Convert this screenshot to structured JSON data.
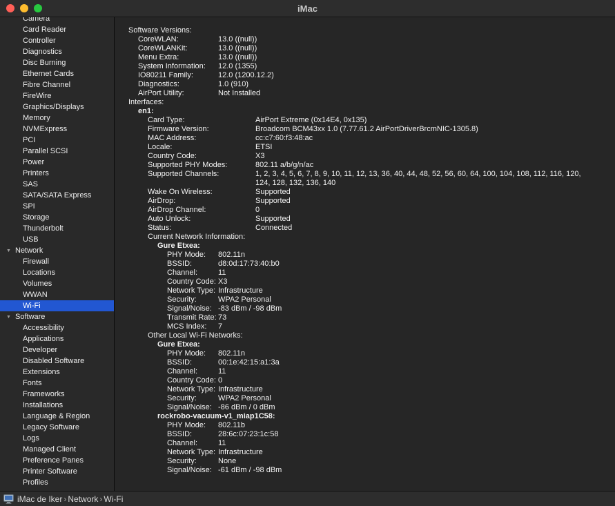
{
  "window": {
    "title": "iMac"
  },
  "colors": {
    "selection": "#2257d2",
    "close": "#ff5f57",
    "minimize": "#febc2e",
    "zoom": "#28c840"
  },
  "icons": {
    "disclosure": "▼"
  },
  "sidebar": {
    "items": [
      {
        "label": "Camera",
        "type": "item"
      },
      {
        "label": "Card Reader",
        "type": "item"
      },
      {
        "label": "Controller",
        "type": "item"
      },
      {
        "label": "Diagnostics",
        "type": "item"
      },
      {
        "label": "Disc Burning",
        "type": "item"
      },
      {
        "label": "Ethernet Cards",
        "type": "item"
      },
      {
        "label": "Fibre Channel",
        "type": "item"
      },
      {
        "label": "FireWire",
        "type": "item"
      },
      {
        "label": "Graphics/Displays",
        "type": "item"
      },
      {
        "label": "Memory",
        "type": "item"
      },
      {
        "label": "NVMExpress",
        "type": "item"
      },
      {
        "label": "PCI",
        "type": "item"
      },
      {
        "label": "Parallel SCSI",
        "type": "item"
      },
      {
        "label": "Power",
        "type": "item"
      },
      {
        "label": "Printers",
        "type": "item"
      },
      {
        "label": "SAS",
        "type": "item"
      },
      {
        "label": "SATA/SATA Express",
        "type": "item"
      },
      {
        "label": "SPI",
        "type": "item"
      },
      {
        "label": "Storage",
        "type": "item"
      },
      {
        "label": "Thunderbolt",
        "type": "item"
      },
      {
        "label": "USB",
        "type": "item"
      },
      {
        "label": "Network",
        "type": "section"
      },
      {
        "label": "Firewall",
        "type": "item"
      },
      {
        "label": "Locations",
        "type": "item"
      },
      {
        "label": "Volumes",
        "type": "item"
      },
      {
        "label": "WWAN",
        "type": "item"
      },
      {
        "label": "Wi-Fi",
        "type": "item",
        "selected": true
      },
      {
        "label": "Software",
        "type": "section"
      },
      {
        "label": "Accessibility",
        "type": "item"
      },
      {
        "label": "Applications",
        "type": "item"
      },
      {
        "label": "Developer",
        "type": "item"
      },
      {
        "label": "Disabled Software",
        "type": "item"
      },
      {
        "label": "Extensions",
        "type": "item"
      },
      {
        "label": "Fonts",
        "type": "item"
      },
      {
        "label": "Frameworks",
        "type": "item"
      },
      {
        "label": "Installations",
        "type": "item"
      },
      {
        "label": "Language & Region",
        "type": "item"
      },
      {
        "label": "Legacy Software",
        "type": "item"
      },
      {
        "label": "Logs",
        "type": "item"
      },
      {
        "label": "Managed Client",
        "type": "item"
      },
      {
        "label": "Preference Panes",
        "type": "item"
      },
      {
        "label": "Printer Software",
        "type": "item"
      },
      {
        "label": "Profiles",
        "type": "item"
      }
    ]
  },
  "report": {
    "rows": [
      {
        "indent": 0,
        "label": "Software Versions:"
      },
      {
        "indent": 1,
        "label": "CoreWLAN:",
        "value": "13.0 ((null))",
        "col": "a"
      },
      {
        "indent": 1,
        "label": "CoreWLANKit:",
        "value": "13.0 ((null))",
        "col": "a"
      },
      {
        "indent": 1,
        "label": "Menu Extra:",
        "value": "13.0 ((null))",
        "col": "a"
      },
      {
        "indent": 1,
        "label": "System Information:",
        "value": "12.0 (1355)",
        "col": "a"
      },
      {
        "indent": 1,
        "label": "IO80211 Family:",
        "value": "12.0 (1200.12.2)",
        "col": "a"
      },
      {
        "indent": 1,
        "label": "Diagnostics:",
        "value": "1.0 (910)",
        "col": "a"
      },
      {
        "indent": 1,
        "label": "AirPort Utility:",
        "value": "Not Installed",
        "col": "a"
      },
      {
        "indent": 0,
        "label": "Interfaces:"
      },
      {
        "indent": 1,
        "label": "en1:",
        "bold": true
      },
      {
        "indent": 2,
        "label": "Card Type:",
        "value": "AirPort Extreme  (0x14E4, 0x135)",
        "col": "b"
      },
      {
        "indent": 2,
        "label": "Firmware Version:",
        "value": "Broadcom BCM43xx 1.0 (7.77.61.2 AirPortDriverBrcmNIC-1305.8)",
        "col": "b"
      },
      {
        "indent": 2,
        "label": "MAC Address:",
        "value": "cc:c7:60:f3:48:ac",
        "col": "b"
      },
      {
        "indent": 2,
        "label": "Locale:",
        "value": "ETSI",
        "col": "b"
      },
      {
        "indent": 2,
        "label": "Country Code:",
        "value": "X3",
        "col": "b"
      },
      {
        "indent": 2,
        "label": "Supported PHY Modes:",
        "value": "802.11 a/b/g/n/ac",
        "col": "b"
      },
      {
        "indent": 2,
        "label": "Supported Channels:",
        "value": "1, 2, 3, 4, 5, 6, 7, 8, 9, 10, 11, 12, 13, 36, 40, 44, 48, 52, 56, 60, 64, 100, 104, 108, 112, 116, 120, 124, 128, 132, 136, 140",
        "col": "b"
      },
      {
        "indent": 2,
        "label": "Wake On Wireless:",
        "value": "Supported",
        "col": "b"
      },
      {
        "indent": 2,
        "label": "AirDrop:",
        "value": "Supported",
        "col": "b"
      },
      {
        "indent": 2,
        "label": "AirDrop Channel:",
        "value": "0",
        "col": "b"
      },
      {
        "indent": 2,
        "label": "Auto Unlock:",
        "value": "Supported",
        "col": "b"
      },
      {
        "indent": 2,
        "label": "Status:",
        "value": "Connected",
        "col": "b"
      },
      {
        "indent": 2,
        "label": "Current Network Information:",
        "col": "b"
      },
      {
        "indent": 3,
        "label": "Gure Etxea:",
        "bold": true
      },
      {
        "indent": 4,
        "label": "PHY Mode:",
        "value": "802.11n",
        "col": "a"
      },
      {
        "indent": 4,
        "label": "BSSID:",
        "value": "d8:0d:17:73:40:b0",
        "col": "a"
      },
      {
        "indent": 4,
        "label": "Channel:",
        "value": "11",
        "col": "a"
      },
      {
        "indent": 4,
        "label": "Country Code:",
        "value": "X3",
        "col": "a"
      },
      {
        "indent": 4,
        "label": "Network Type:",
        "value": "Infrastructure",
        "col": "a"
      },
      {
        "indent": 4,
        "label": "Security:",
        "value": "WPA2 Personal",
        "col": "a"
      },
      {
        "indent": 4,
        "label": "Signal/Noise:",
        "value": "-83 dBm / -98 dBm",
        "col": "a"
      },
      {
        "indent": 4,
        "label": "Transmit Rate:",
        "value": "73",
        "col": "a"
      },
      {
        "indent": 4,
        "label": "MCS Index:",
        "value": "7",
        "col": "a"
      },
      {
        "indent": 2,
        "label": "Other Local Wi-Fi Networks:",
        "col": "b"
      },
      {
        "indent": 3,
        "label": "Gure Etxea:",
        "bold": true
      },
      {
        "indent": 4,
        "label": "PHY Mode:",
        "value": "802.11n",
        "col": "a"
      },
      {
        "indent": 4,
        "label": "BSSID:",
        "value": "00:1e:42:15:a1:3a",
        "col": "a"
      },
      {
        "indent": 4,
        "label": "Channel:",
        "value": "11",
        "col": "a"
      },
      {
        "indent": 4,
        "label": "Country Code:",
        "value": "0",
        "col": "a"
      },
      {
        "indent": 4,
        "label": "Network Type:",
        "value": "Infrastructure",
        "col": "a"
      },
      {
        "indent": 4,
        "label": "Security:",
        "value": "WPA2 Personal",
        "col": "a"
      },
      {
        "indent": 4,
        "label": "Signal/Noise:",
        "value": "-86 dBm / 0 dBm",
        "col": "a"
      },
      {
        "indent": 3,
        "label": "rockrobo-vacuum-v1_miap1C58:",
        "bold": true
      },
      {
        "indent": 4,
        "label": "PHY Mode:",
        "value": "802.11b",
        "col": "a"
      },
      {
        "indent": 4,
        "label": "BSSID:",
        "value": "28:6c:07:23:1c:58",
        "col": "a"
      },
      {
        "indent": 4,
        "label": "Channel:",
        "value": "11",
        "col": "a"
      },
      {
        "indent": 4,
        "label": "Network Type:",
        "value": "Infrastructure",
        "col": "a"
      },
      {
        "indent": 4,
        "label": "Security:",
        "value": "None",
        "col": "a"
      },
      {
        "indent": 4,
        "label": "Signal/Noise:",
        "value": "-61 dBm / -98 dBm",
        "col": "a"
      }
    ]
  },
  "statusbar": {
    "separator": "›",
    "path": [
      "iMac de Iker",
      "Network",
      "Wi-Fi"
    ]
  }
}
